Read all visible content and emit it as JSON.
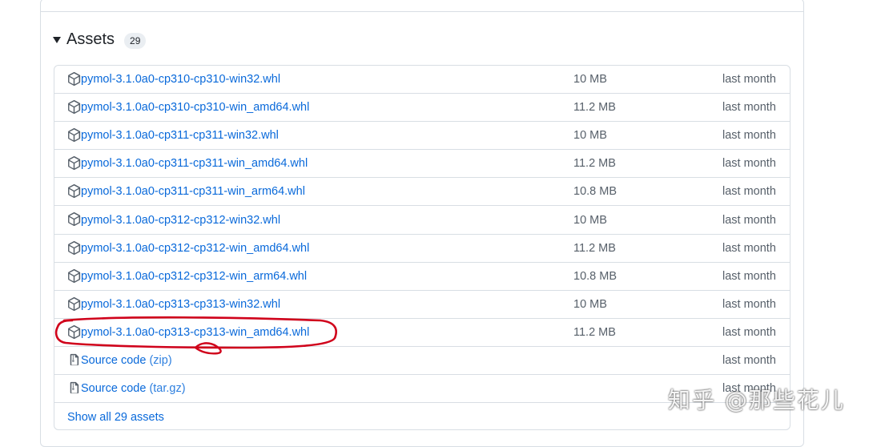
{
  "section": {
    "title": "Assets",
    "count": "29"
  },
  "assets": [
    {
      "name": "pymol-3.1.0a0-cp310-cp310-win32.whl",
      "size": "10 MB",
      "date": "last month"
    },
    {
      "name": "pymol-3.1.0a0-cp310-cp310-win_amd64.whl",
      "size": "11.2 MB",
      "date": "last month"
    },
    {
      "name": "pymol-3.1.0a0-cp311-cp311-win32.whl",
      "size": "10 MB",
      "date": "last month"
    },
    {
      "name": "pymol-3.1.0a0-cp311-cp311-win_amd64.whl",
      "size": "11.2 MB",
      "date": "last month"
    },
    {
      "name": "pymol-3.1.0a0-cp311-cp311-win_arm64.whl",
      "size": "10.8 MB",
      "date": "last month"
    },
    {
      "name": "pymol-3.1.0a0-cp312-cp312-win32.whl",
      "size": "10 MB",
      "date": "last month"
    },
    {
      "name": "pymol-3.1.0a0-cp312-cp312-win_amd64.whl",
      "size": "11.2 MB",
      "date": "last month"
    },
    {
      "name": "pymol-3.1.0a0-cp312-cp312-win_arm64.whl",
      "size": "10.8 MB",
      "date": "last month"
    },
    {
      "name": "pymol-3.1.0a0-cp313-cp313-win32.whl",
      "size": "10 MB",
      "date": "last month"
    },
    {
      "name": "pymol-3.1.0a0-cp313-cp313-win_amd64.whl",
      "size": "11.2 MB",
      "date": "last month"
    }
  ],
  "sources": [
    {
      "label": "Source code",
      "format": "(zip)",
      "date": "last month"
    },
    {
      "label": "Source code",
      "format": "(tar.gz)",
      "date": "last month"
    }
  ],
  "show_all_label": "Show all 29 assets",
  "watermark": "知乎 @那些花儿",
  "icons": {
    "package": "package-icon",
    "zip": "file-zip-icon",
    "caret": "triangle-down-icon"
  },
  "colors": {
    "link": "#0969da",
    "muted": "#57606a",
    "annotation": "#d0021b"
  }
}
